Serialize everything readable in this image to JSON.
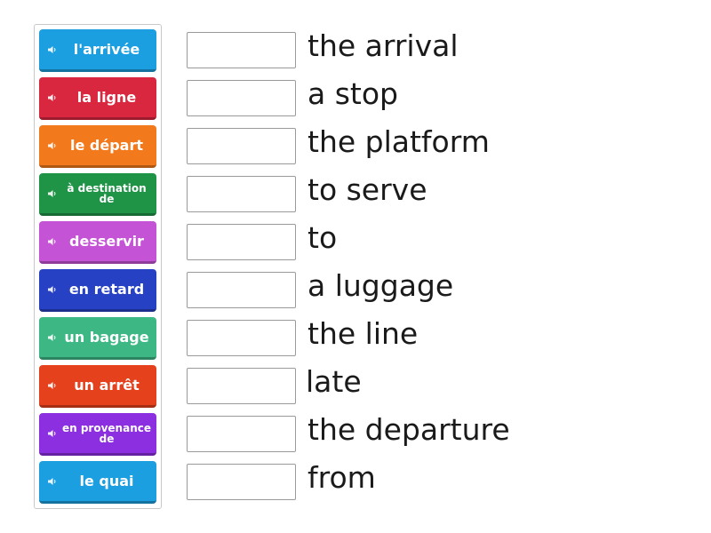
{
  "tiles": [
    {
      "label": "l'arrivée",
      "color": "#1c9fe0",
      "icon": "speaker-icon"
    },
    {
      "label": "la ligne",
      "color": "#d9273f",
      "icon": "speaker-icon"
    },
    {
      "label": "le départ",
      "color": "#f27a1d",
      "icon": "speaker-icon"
    },
    {
      "label": "à destination de",
      "color": "#1f9447",
      "icon": "speaker-icon"
    },
    {
      "label": "desservir",
      "color": "#c553d6",
      "icon": "speaker-icon"
    },
    {
      "label": "en retard",
      "color": "#2741c4",
      "icon": "speaker-icon"
    },
    {
      "label": "un bagage",
      "color": "#3db885",
      "icon": "speaker-icon"
    },
    {
      "label": "un arrêt",
      "color": "#e5411c",
      "icon": "speaker-icon"
    },
    {
      "label": "en provenance de",
      "color": "#8b2fe0",
      "icon": "speaker-icon"
    },
    {
      "label": "le quai",
      "color": "#1c9fe0",
      "icon": "speaker-icon"
    }
  ],
  "words": [
    "the arrival",
    "a stop",
    "the platform",
    "to serve",
    "to",
    "a luggage",
    "the line",
    "late",
    "the departure",
    "from"
  ]
}
